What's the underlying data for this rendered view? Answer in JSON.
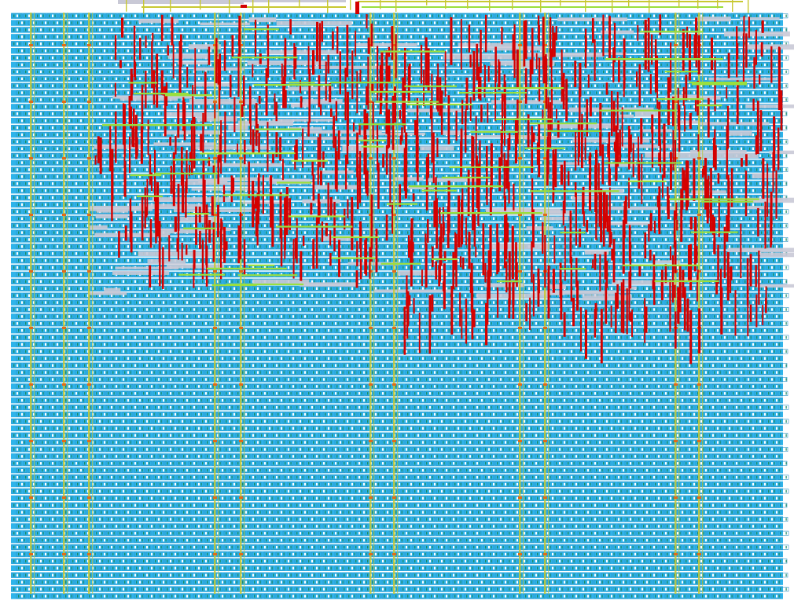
{
  "layout": {
    "description_visible": false,
    "colors": {
      "background": "#ffffff",
      "cell_fill": "#2fb4ea",
      "cell_outline": "#2a8fc4",
      "pin_green": "#1c8a63",
      "pin_white": "#ffffff",
      "supply_rail": "#c8c832",
      "clock_tree": "#b8c84a",
      "metal_vertical": "#d40000",
      "metal_horizontal": "#9adf3e",
      "blockage_grey": "#c9c9d6",
      "top_routes": "#c8c832"
    },
    "layers": [
      "std-cell-rows",
      "power-straps",
      "metal-vertical-routes",
      "metal-horizontal-routes",
      "top-io-routes"
    ]
  }
}
